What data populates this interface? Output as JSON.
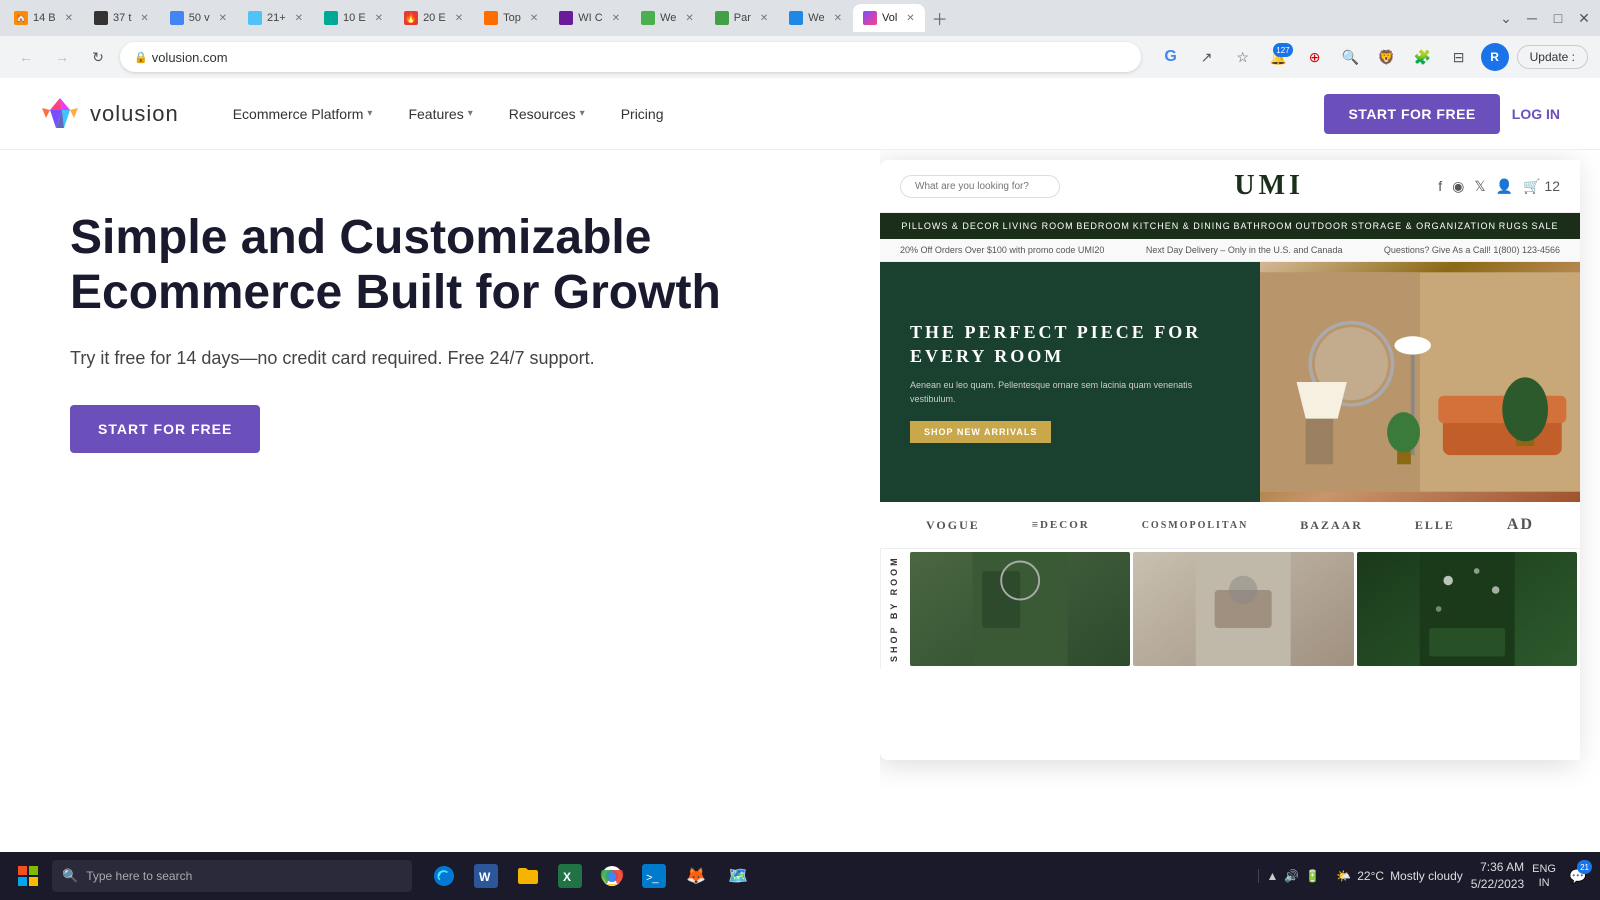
{
  "browser": {
    "tabs": [
      {
        "id": 1,
        "label": "14 B",
        "favicon_color": "#ff8c00",
        "active": false
      },
      {
        "id": 2,
        "label": "37 t",
        "favicon_color": "#333",
        "active": false
      },
      {
        "id": 3,
        "label": "50 v",
        "favicon_color": "#4285f4",
        "active": false
      },
      {
        "id": 4,
        "label": "21+",
        "favicon_color": "#4fc3f7",
        "active": false
      },
      {
        "id": 5,
        "label": "10 E",
        "favicon_color": "#00a896",
        "active": false
      },
      {
        "id": 6,
        "label": "20 E",
        "favicon_color": "#e53935",
        "active": false
      },
      {
        "id": 7,
        "label": "Top",
        "favicon_color": "#ff6d00",
        "active": false
      },
      {
        "id": 8,
        "label": "WI C",
        "favicon_color": "#6a1b9a",
        "active": false
      },
      {
        "id": 9,
        "label": "We",
        "favicon_color": "#4caf50",
        "active": false
      },
      {
        "id": 10,
        "label": "Par",
        "favicon_color": "#43a047",
        "active": false
      },
      {
        "id": 11,
        "label": "We",
        "favicon_color": "#1e88e5",
        "active": false
      },
      {
        "id": 12,
        "label": "Vol",
        "favicon_color": "#7c4dff",
        "active": true
      }
    ],
    "address": "volusion.com",
    "notification_count": "127",
    "profile_initial": "R",
    "update_label": "Update :"
  },
  "volusion": {
    "logo_text": "volusion",
    "nav": {
      "platform_label": "Ecommerce Platform",
      "features_label": "Features",
      "resources_label": "Resources",
      "pricing_label": "Pricing"
    },
    "cta_start": "START FOR FREE",
    "cta_login": "LOG IN",
    "hero": {
      "title": "Simple and Customizable Ecommerce Built for Growth",
      "subtitle": "Try it free for 14 days—no credit card required. Free 24/7 support.",
      "cta_label": "START FOR FREE"
    }
  },
  "umi_store": {
    "search_placeholder": "What are you looking for?",
    "logo": "UMI",
    "nav_items": [
      "PILLOWS & DECOR",
      "LIVING ROOM",
      "BEDROOM",
      "KITCHEN & DINING",
      "BATHROOM",
      "OUTDOOR",
      "STORAGE & ORGANIZATION",
      "RUGS",
      "SALE"
    ],
    "banner_items": [
      "20% Off Orders Over $100 with promo code UMI20",
      "Next Day Delivery – Only in the U.S. and Canada",
      "Questions? Give As a Call! 1(800) 123-4566"
    ],
    "hero_tagline": "THE PERFECT PIECE FOR EVERY ROOM",
    "hero_subtitle": "Aenean eu leo quam. Pellentesque ornare sem lacinia quam venenatis vestibulum.",
    "hero_btn": "SHOP NEW ARRIVALS",
    "brands": [
      "VOGUE",
      "≡DECOR",
      "COSMOPOLITAN",
      "BAZAAR",
      "ELLE",
      "AD"
    ],
    "shop_by_room_label": "SHOP BY ROOM"
  },
  "taskbar": {
    "search_placeholder": "Type here to search",
    "weather_temp": "22°C",
    "weather_desc": "Mostly cloudy",
    "time": "7:36 AM",
    "date": "5/22/2023",
    "lang1": "ENG",
    "lang2": "IN",
    "notification_count": "21"
  }
}
